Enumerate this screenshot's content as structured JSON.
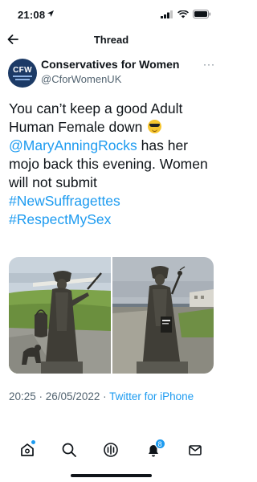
{
  "status_bar": {
    "time": "21:08",
    "icons": [
      "location-arrow-icon",
      "cellular-signal-icon",
      "wifi-icon",
      "battery-icon"
    ]
  },
  "nav": {
    "title": "Thread",
    "back_icon": "back-arrow-icon"
  },
  "tweet": {
    "author": {
      "display_name": "Conservatives for Women",
      "handle": "@CforWomenUK",
      "avatar_text": "CFW"
    },
    "more_label": "···",
    "text": {
      "line1": "You can’t keep a good Adult Human Female down",
      "mention": "@MaryAnningRocks",
      "after_mention": " has her mojo back this evening. Women will not submit",
      "hashtag1": "#NewSuffragettes",
      "hashtag2": "#RespectMySex"
    },
    "emoji": "smiling-face-with-sunglasses",
    "media": [
      {
        "description_icon": "statue-photo-1"
      },
      {
        "description_icon": "statue-photo-2"
      }
    ],
    "timestamp": {
      "time_date": "20:25 · 26/05/2022 · ",
      "source": "Twitter for iPhone"
    }
  },
  "tab_bar": {
    "items": [
      {
        "name": "home",
        "icon": "home-icon",
        "has_dot": true
      },
      {
        "name": "search",
        "icon": "search-icon"
      },
      {
        "name": "spaces",
        "icon": "spaces-icon"
      },
      {
        "name": "notifications",
        "icon": "bell-icon",
        "badge": "8"
      },
      {
        "name": "messages",
        "icon": "mail-icon"
      }
    ]
  },
  "colors": {
    "accent": "#1d9bf0",
    "text": "#0f1419",
    "secondary": "#536471"
  }
}
